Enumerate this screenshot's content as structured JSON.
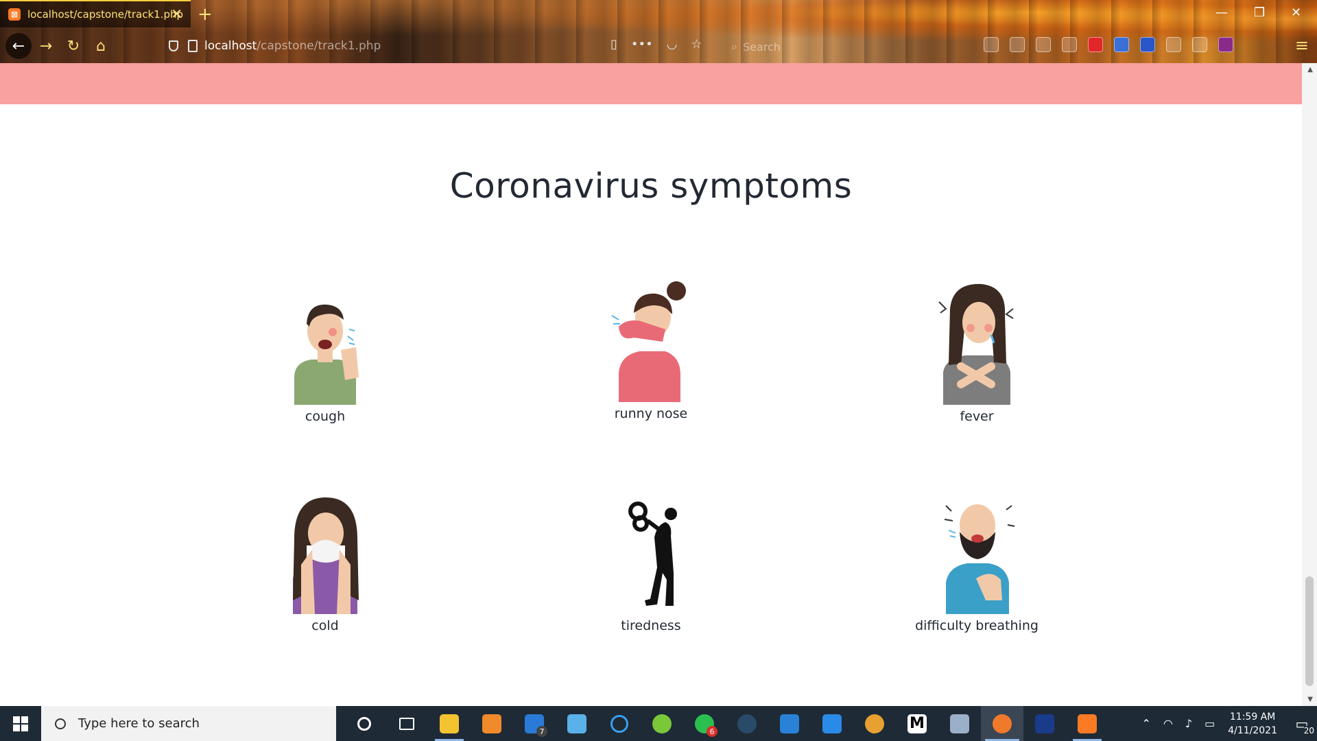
{
  "browser": {
    "tab_title": "localhost/capstone/track1.php",
    "tab_close": "✕",
    "new_tab": "+",
    "url_host": "localhost",
    "url_path": "/capstone/track1.php",
    "search_placeholder": "Search"
  },
  "page": {
    "title": "Coronavirus symptoms",
    "symptoms": [
      {
        "label": "cough",
        "icon": "coughing-man-icon"
      },
      {
        "label": "runny nose",
        "icon": "sneezing-woman-icon"
      },
      {
        "label": "fever",
        "icon": "feverish-woman-icon"
      },
      {
        "label": "cold",
        "icon": "woman-blowing-nose-icon"
      },
      {
        "label": "tiredness",
        "icon": "tired-person-icon"
      },
      {
        "label": "difficulty breathing",
        "icon": "man-breathing-difficulty-icon"
      }
    ],
    "colors": {
      "banner": "#f9a0a0",
      "title": "#222933"
    }
  },
  "taskbar": {
    "search_placeholder": "Type here to search",
    "mail_badge": "7",
    "whatsapp_badge": "6",
    "time": "11:59 AM",
    "date": "4/11/2021",
    "notification_count": "20"
  }
}
